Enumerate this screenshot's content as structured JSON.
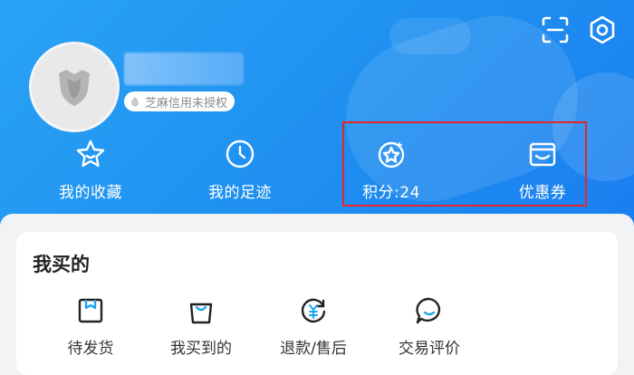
{
  "header": {
    "credit_badge": "芝麻信用未授权"
  },
  "quick_actions": [
    {
      "label": "我的收藏",
      "icon": "star-icon"
    },
    {
      "label": "我的足迹",
      "icon": "clock-icon"
    },
    {
      "label": "积分:24",
      "icon": "points-icon"
    },
    {
      "label": "优惠券",
      "icon": "coupon-icon"
    }
  ],
  "orders": {
    "title": "我买的",
    "items": [
      {
        "label": "待发货",
        "icon": "box-icon"
      },
      {
        "label": "我买到的",
        "icon": "bag-icon"
      },
      {
        "label": "退款/售后",
        "icon": "refund-icon"
      },
      {
        "label": "交易评价",
        "icon": "review-icon"
      }
    ]
  },
  "colors": {
    "header_blue": "#1f8ff0",
    "highlight_red": "#e3262b",
    "icon_dark": "#222222",
    "icon_accent": "#1aa4f5"
  }
}
